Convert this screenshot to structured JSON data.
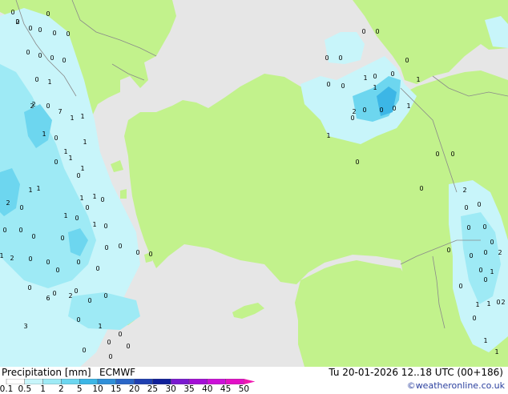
{
  "header": {
    "title": "Precipitation [mm]",
    "model": "ECMWF",
    "valid_time": "Tu 20-01-2026 12..18 UTC (00+186)"
  },
  "credit": "©weatheronline.co.uk",
  "legend": {
    "values": [
      "0.1",
      "0.5",
      "1",
      "2",
      "5",
      "10",
      "15",
      "20",
      "25",
      "30",
      "35",
      "40",
      "45",
      "50"
    ],
    "colors": [
      "#ffffff",
      "#c8f5fa",
      "#9eeaf5",
      "#6dd6ef",
      "#3cb6e6",
      "#2f8fd8",
      "#2a66c7",
      "#1f3fb0",
      "#10209a",
      "#7a1ad0",
      "#a30fd6",
      "#cc10d8",
      "#e310c6",
      "#f018b0"
    ]
  },
  "map": {
    "colors": {
      "sea": "#e6e6e6",
      "land": "#c2f28c",
      "light_precip": "#c8f5fa",
      "mid_precip": "#9eeaf5",
      "heavy_precip": "#6dd6ef",
      "peak_precip": "#3cb6e6",
      "border": "#8a8a8a"
    },
    "labels": [
      {
        "t": "0"
      },
      {
        "t": "0"
      },
      {
        "t": "0"
      },
      {
        "t": "0"
      },
      {
        "t": "0"
      },
      {
        "t": "0"
      },
      {
        "t": "0"
      },
      {
        "t": "0"
      },
      {
        "t": "1"
      },
      {
        "t": "0"
      },
      {
        "t": "2"
      },
      {
        "t": "0"
      },
      {
        "t": "7"
      },
      {
        "t": "1"
      },
      {
        "t": "1"
      },
      {
        "t": "1"
      },
      {
        "t": "1"
      },
      {
        "t": "0"
      },
      {
        "t": "2"
      },
      {
        "t": "1"
      },
      {
        "t": "1"
      },
      {
        "t": "0"
      },
      {
        "t": "1"
      },
      {
        "t": "0"
      },
      {
        "t": "1"
      },
      {
        "t": "2"
      },
      {
        "t": "0"
      },
      {
        "t": "1"
      },
      {
        "t": "1"
      },
      {
        "t": "0"
      },
      {
        "t": "1"
      },
      {
        "t": "0"
      },
      {
        "t": "0"
      },
      {
        "t": "1"
      },
      {
        "t": "0"
      },
      {
        "t": "1"
      },
      {
        "t": "2"
      },
      {
        "t": "0"
      },
      {
        "t": "0"
      },
      {
        "t": "0"
      },
      {
        "t": "1"
      },
      {
        "t": "0"
      },
      {
        "t": "0"
      },
      {
        "t": "0"
      },
      {
        "t": "0"
      },
      {
        "t": "0"
      },
      {
        "t": "0"
      },
      {
        "t": "0"
      },
      {
        "t": "0"
      },
      {
        "t": "0"
      },
      {
        "t": "0"
      },
      {
        "t": "0"
      },
      {
        "t": "0"
      },
      {
        "t": "0"
      },
      {
        "t": "2"
      },
      {
        "t": "6"
      },
      {
        "t": "3"
      },
      {
        "t": "0"
      },
      {
        "t": "0"
      },
      {
        "t": "0"
      },
      {
        "t": "0"
      },
      {
        "t": "0"
      },
      {
        "t": "0"
      },
      {
        "t": "0"
      },
      {
        "t": "0"
      },
      {
        "t": "2"
      },
      {
        "t": "0"
      },
      {
        "t": "0"
      },
      {
        "t": "1"
      },
      {
        "t": "1"
      },
      {
        "t": "1"
      },
      {
        "t": "0"
      },
      {
        "t": "0"
      },
      {
        "t": "0"
      },
      {
        "t": "0"
      },
      {
        "t": "0"
      },
      {
        "t": "0"
      },
      {
        "t": "0"
      },
      {
        "t": "0"
      },
      {
        "t": "0"
      },
      {
        "t": "2"
      },
      {
        "t": "1"
      },
      {
        "t": "0"
      },
      {
        "t": "0"
      },
      {
        "t": "1"
      },
      {
        "t": "1"
      },
      {
        "t": "2"
      },
      {
        "t": "0"
      },
      {
        "t": "0"
      },
      {
        "t": "0"
      },
      {
        "t": "0"
      },
      {
        "t": "0"
      },
      {
        "t": "0"
      },
      {
        "t": "1"
      },
      {
        "t": "1"
      },
      {
        "t": "2"
      },
      {
        "t": "0"
      },
      {
        "t": "0"
      },
      {
        "t": "0"
      },
      {
        "t": "0"
      },
      {
        "t": "0"
      },
      {
        "t": "0"
      },
      {
        "t": "1"
      },
      {
        "t": "0"
      },
      {
        "t": "1"
      },
      {
        "t": "0"
      },
      {
        "t": "0"
      },
      {
        "t": "2"
      },
      {
        "t": "0"
      },
      {
        "t": "0"
      },
      {
        "t": "1"
      },
      {
        "t": "0"
      },
      {
        "t": "0"
      },
      {
        "t": "0"
      }
    ]
  }
}
